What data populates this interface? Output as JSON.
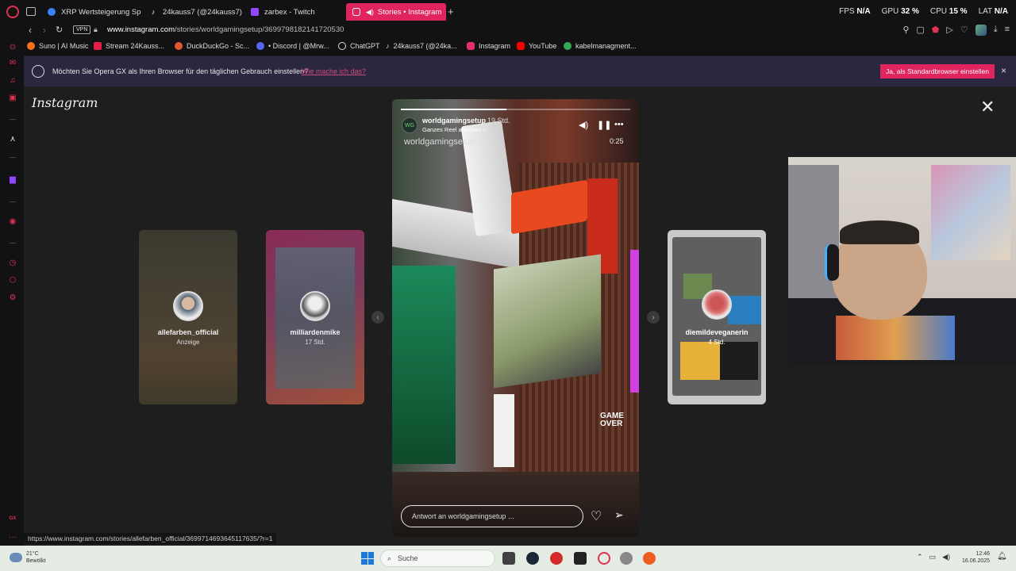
{
  "browser": {
    "tabs": [
      {
        "label": "XRP Wertsteigerung Spe...",
        "icon_color": "#3b82f6"
      },
      {
        "label": "24kauss7 (@24kauss7) |",
        "icon_color": "#111111"
      },
      {
        "label": "zarbex - Twitch",
        "icon_color": "#9146ff"
      },
      {
        "label": "Stories • Instagram",
        "icon_color": "#ffffff",
        "active": true
      }
    ],
    "performance": {
      "fps_label": "FPS",
      "fps_value": "N/A",
      "gpu_label": "GPU",
      "gpu_value": "32 %",
      "cpu_label": "CPU",
      "cpu_value": "15 %",
      "lat_label": "LAT",
      "lat_value": "N/A"
    },
    "vpn_label": "VPN",
    "url_host": "www.instagram.com",
    "url_path": "/stories/worldgamingsetup/3699798182141720530",
    "bookmarks": [
      {
        "label": "Suno | AI Music",
        "color": "#f97316"
      },
      {
        "label": "Stream 24Kauss...",
        "color": "#e11d48"
      },
      {
        "label": "DuckDuckGo - Sc...",
        "color": "#de5833"
      },
      {
        "label": "• Discord | @Mrw...",
        "color": "#5865f2"
      },
      {
        "label": "ChatGPT",
        "color": "#dddddd"
      },
      {
        "label": "24kauss7 (@24ka...",
        "color": "#111111"
      },
      {
        "label": "Instagram",
        "color": "#e1306c"
      },
      {
        "label": "YouTube",
        "color": "#ff0000"
      },
      {
        "label": "kabelmanagment...",
        "color": "#34a853"
      }
    ],
    "sidebar_icons": [
      "news-icon",
      "messenger-icon",
      "music-icon",
      "arrow-icon",
      "twitch-icon",
      "player-icon",
      "history-icon",
      "extensions-icon",
      "settings-icon",
      "gx-icon",
      "more-icon"
    ],
    "gx_label": "GX",
    "status_url": "https://www.instagram.com/stories/allefarben_official/3699714693645117635/?r=1"
  },
  "banner": {
    "text": "Möchten Sie Opera GX als Ihren Browser für den täglichen Gebrauch einstellen?",
    "link": "Wie mache ich das?",
    "button": "Ja, als Standardbrowser einstellen",
    "close": "×"
  },
  "instagram": {
    "logo": "Instagram",
    "close": "✕",
    "side_stories": [
      {
        "name": "allefarben_official",
        "sub": "Anzeige"
      },
      {
        "name": "milliardenmike",
        "sub": "17 Std."
      },
      {
        "name": "diemildeveganerin",
        "sub": "4 Std."
      }
    ],
    "story": {
      "avatar_text": "WG",
      "user": "worldgamingsetup",
      "time": "19 Std.",
      "reel_link": "Ganzes Reel ansehen ›",
      "overlay_title": "worldgamingsetup",
      "duration": "0:25",
      "progress": 0.46,
      "sign_text": "GAME OVER",
      "reply_placeholder": "Antwort an worldgamingsetup ..."
    }
  },
  "taskbar": {
    "weather_temp": "21°C",
    "weather_desc": "Bewölkt",
    "search_label": "Suche",
    "apps": [
      {
        "name": "files",
        "color": "#404040"
      },
      {
        "name": "steam",
        "color": "#1b2838"
      },
      {
        "name": "app-red",
        "color": "#d22b2b"
      },
      {
        "name": "epic",
        "color": "#222222"
      },
      {
        "name": "opera",
        "color": "#e03352"
      },
      {
        "name": "app-gear",
        "color": "#888888"
      },
      {
        "name": "ea",
        "color": "#ef5b25"
      }
    ],
    "time": "12:46",
    "date": "16.06.2025"
  }
}
